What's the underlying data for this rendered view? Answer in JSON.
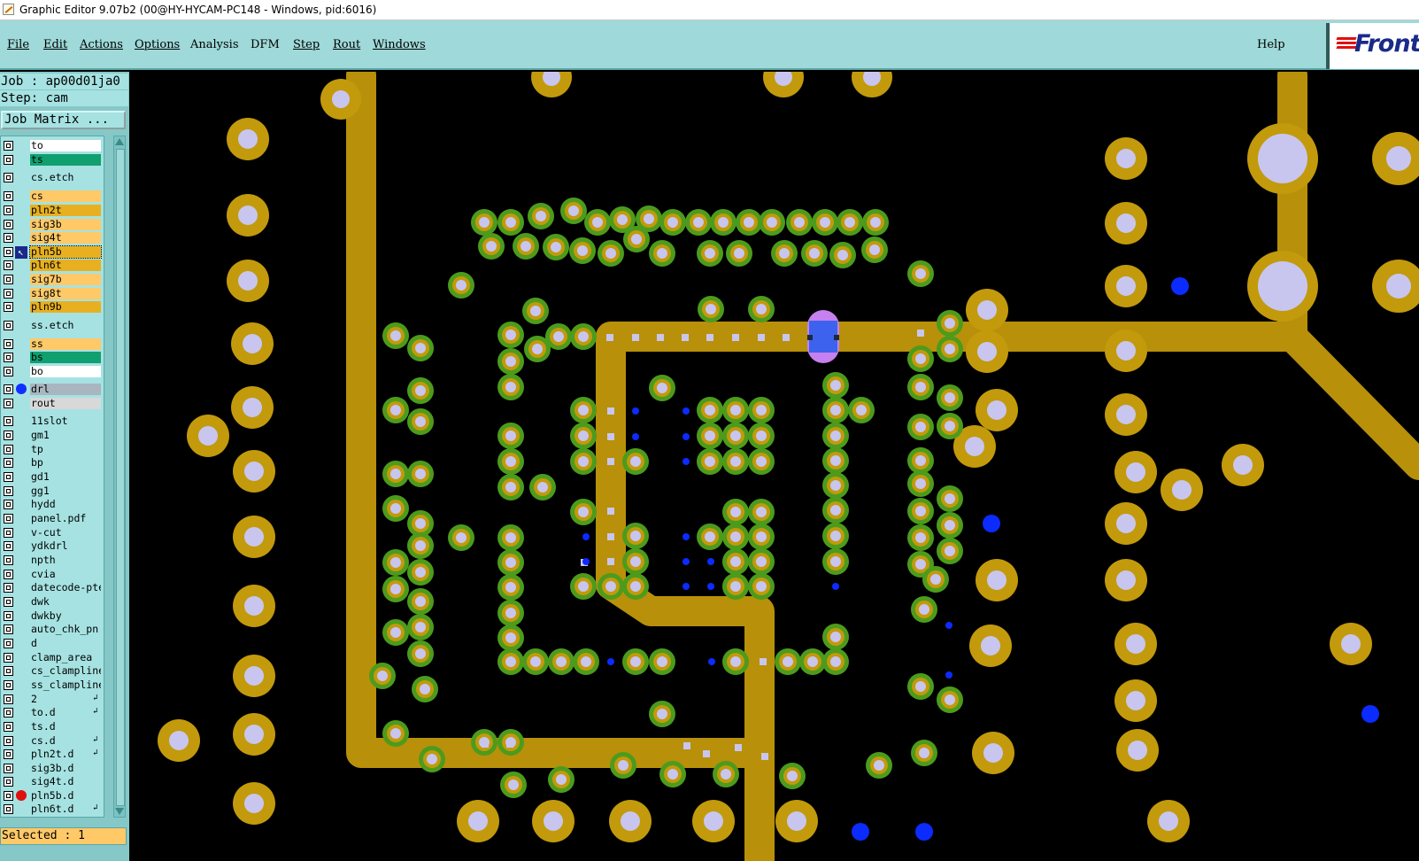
{
  "window": {
    "title": "Graphic Editor 9.07b2 (00@HY-HYCAM-PC148 - Windows, pid:6016)"
  },
  "menubar": {
    "items": [
      {
        "label": "File"
      },
      {
        "label": "Edit"
      },
      {
        "label": "Actions"
      },
      {
        "label": "Options"
      },
      {
        "label": "Analysis"
      },
      {
        "label": "DFM"
      },
      {
        "label": "Step"
      },
      {
        "label": "Rout"
      },
      {
        "label": "Windows"
      }
    ],
    "help": "Help",
    "logo_text": "Front"
  },
  "sidebar": {
    "job": "Job : ap00d01ja0",
    "step": "Step: cam",
    "job_matrix_button": "Job Matrix ...",
    "selected_status": "Selected : 1",
    "layers": [
      {
        "name": "to",
        "color": "#ffffff"
      },
      {
        "name": "ts",
        "color": "#10a070"
      },
      {
        "name": "cs.etch",
        "color": "#a6e2e2"
      },
      {
        "name": "cs",
        "color": "#ffc968"
      },
      {
        "name": "pln2t",
        "color": "#e8b020"
      },
      {
        "name": "sig3b",
        "color": "#ffc968"
      },
      {
        "name": "sig4t",
        "color": "#ffc968"
      },
      {
        "name": "pln5b",
        "color": "#e8b020",
        "active": true
      },
      {
        "name": "pln6t",
        "color": "#e8b020"
      },
      {
        "name": "sig7b",
        "color": "#ffc968"
      },
      {
        "name": "sig8t",
        "color": "#ffc968"
      },
      {
        "name": "pln9b",
        "color": "#e8b020"
      },
      {
        "name": "ss.etch",
        "color": "#a6e2e2"
      },
      {
        "name": "ss",
        "color": "#ffc968"
      },
      {
        "name": "bs",
        "color": "#10a070"
      },
      {
        "name": "bo",
        "color": "#ffffff"
      },
      {
        "name": "drl",
        "color": "#a9b6c0",
        "marker": "#1030ff"
      },
      {
        "name": "rout",
        "color": "#d8d8d8"
      },
      {
        "name": "11slot",
        "color": "#a6e2e2"
      },
      {
        "name": "gm1",
        "color": "#a6e2e2"
      },
      {
        "name": "tp",
        "color": "#a6e2e2"
      },
      {
        "name": "bp",
        "color": "#a6e2e2"
      },
      {
        "name": "gd1",
        "color": "#a6e2e2"
      },
      {
        "name": "gg1",
        "color": "#a6e2e2"
      },
      {
        "name": "hydd",
        "color": "#a6e2e2"
      },
      {
        "name": "panel.pdf",
        "color": "#a6e2e2"
      },
      {
        "name": "v-cut",
        "color": "#a6e2e2"
      },
      {
        "name": "ydkdrl",
        "color": "#a6e2e2"
      },
      {
        "name": "npth",
        "color": "#a6e2e2"
      },
      {
        "name": "cvia",
        "color": "#a6e2e2"
      },
      {
        "name": "datecode-pte",
        "color": "#a6e2e2"
      },
      {
        "name": "dwk",
        "color": "#a6e2e2"
      },
      {
        "name": "dwkby",
        "color": "#a6e2e2"
      },
      {
        "name": "auto_chk_pn",
        "color": "#a6e2e2"
      },
      {
        "name": "d",
        "color": "#a6e2e2"
      },
      {
        "name": "clamp_area",
        "color": "#a6e2e2"
      },
      {
        "name": "cs_clampline",
        "color": "#a6e2e2"
      },
      {
        "name": "ss_clampline",
        "color": "#a6e2e2"
      },
      {
        "name": "2",
        "color": "#a6e2e2",
        "aux": "↲"
      },
      {
        "name": "to.d",
        "color": "#a6e2e2",
        "aux": "↲"
      },
      {
        "name": "ts.d",
        "color": "#a6e2e2"
      },
      {
        "name": "cs.d",
        "color": "#a6e2e2",
        "aux": "↲"
      },
      {
        "name": "pln2t.d",
        "color": "#a6e2e2",
        "aux": "↲"
      },
      {
        "name": "sig3b.d",
        "color": "#a6e2e2"
      },
      {
        "name": "sig4t.d",
        "color": "#a6e2e2"
      },
      {
        "name": "pln5b.d",
        "color": "#a6e2e2",
        "marker": "#e01010"
      },
      {
        "name": "pln6t.d",
        "color": "#a6e2e2",
        "aux": "↲"
      }
    ]
  },
  "colors": {
    "trace": "#b8900a",
    "pad_green": "#4d9b1c",
    "pad_gold": "#c29a0c",
    "drill": "#c8c6ef",
    "blue_dot": "#0b2bff",
    "selected_pad": "#3d63ee",
    "selected_outline": "#c680ef",
    "canvas_bg": "#000000"
  }
}
